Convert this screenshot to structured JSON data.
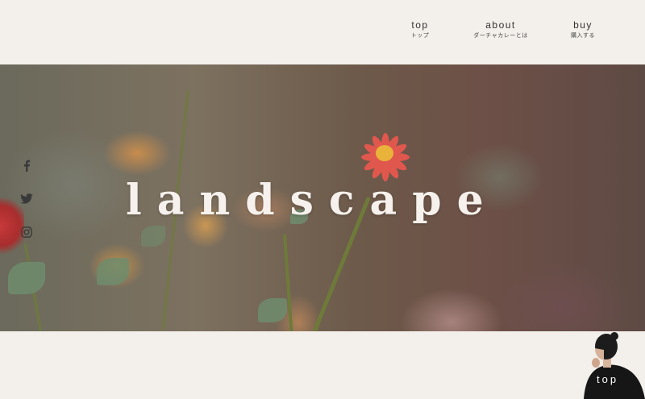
{
  "nav": {
    "items": [
      {
        "en": "top",
        "ja": "トップ"
      },
      {
        "en": "about",
        "ja": "ダーチャカレーとは"
      },
      {
        "en": "buy",
        "ja": "購入する"
      }
    ]
  },
  "hero": {
    "title": "landscape"
  },
  "social": {
    "icons": [
      "facebook-icon",
      "twitter-icon",
      "instagram-icon"
    ]
  },
  "back_to_top": {
    "label": "top"
  },
  "colors": {
    "background": "#f3efea",
    "nav_text": "#333333",
    "hero_title": "#f6f1ec",
    "flower": "#e0574e"
  }
}
